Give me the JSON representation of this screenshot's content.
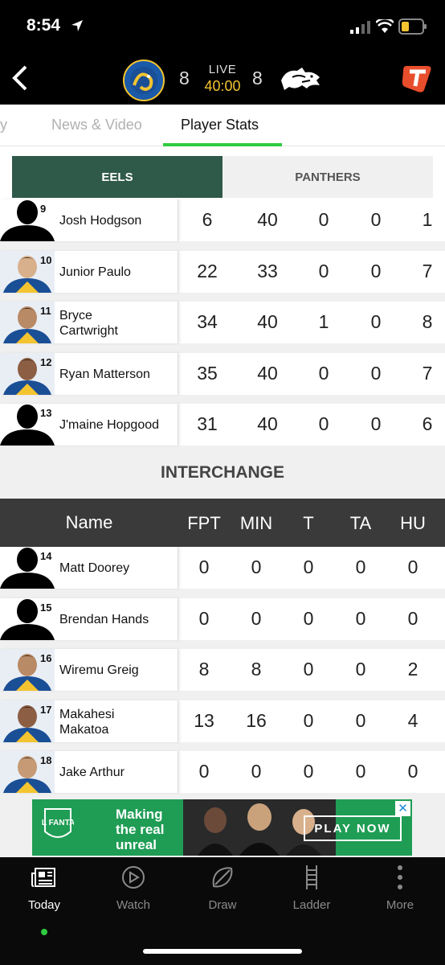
{
  "status_bar": {
    "time": "8:54"
  },
  "header": {
    "home_score": "8",
    "away_score": "8",
    "live_label": "LIVE",
    "clock": "40:00",
    "home_logo": "parramatta-eels-logo",
    "away_logo": "penrith-panthers-logo",
    "sponsor_logo": "telstra-logo",
    "home_logo_text": "PARRAMATTA EELS"
  },
  "tabs": {
    "partial": "ay",
    "news": "News & Video",
    "stats": "Player Stats"
  },
  "team_toggle": {
    "home": "EELS",
    "away": "PANTHERS"
  },
  "starters": [
    {
      "number": "9",
      "name": "Josh Hodgson",
      "fpt": "6",
      "min": "40",
      "t": "0",
      "ta": "0",
      "hu": "1",
      "photo": "silhouette"
    },
    {
      "number": "10",
      "name": "Junior Paulo",
      "fpt": "22",
      "min": "33",
      "t": "0",
      "ta": "0",
      "hu": "7",
      "photo": "headshot"
    },
    {
      "number": "11",
      "name": "Bryce Cartwright",
      "fpt": "34",
      "min": "40",
      "t": "1",
      "ta": "0",
      "hu": "8",
      "photo": "headshot"
    },
    {
      "number": "12",
      "name": "Ryan Matterson",
      "fpt": "35",
      "min": "40",
      "t": "0",
      "ta": "0",
      "hu": "7",
      "photo": "headshot"
    },
    {
      "number": "13",
      "name": "J'maine Hopgood",
      "fpt": "31",
      "min": "40",
      "t": "0",
      "ta": "0",
      "hu": "6",
      "photo": "silhouette"
    }
  ],
  "interchange": {
    "title": "INTERCHANGE",
    "columns": {
      "name": "Name",
      "fpt": "FPT",
      "min": "MIN",
      "t": "T",
      "ta": "TA",
      "hu": "HU"
    },
    "players": [
      {
        "number": "14",
        "name": "Matt Doorey",
        "fpt": "0",
        "min": "0",
        "t": "0",
        "ta": "0",
        "hu": "0",
        "photo": "silhouette"
      },
      {
        "number": "15",
        "name": "Brendan Hands",
        "fpt": "0",
        "min": "0",
        "t": "0",
        "ta": "0",
        "hu": "0",
        "photo": "silhouette"
      },
      {
        "number": "16",
        "name": "Wiremu Greig",
        "fpt": "8",
        "min": "8",
        "t": "0",
        "ta": "0",
        "hu": "2",
        "photo": "headshot"
      },
      {
        "number": "17",
        "name": "Makahesi Makatoa",
        "fpt": "13",
        "min": "16",
        "t": "0",
        "ta": "0",
        "hu": "4",
        "photo": "headshot"
      },
      {
        "number": "18",
        "name": "Jake Arthur",
        "fpt": "0",
        "min": "0",
        "t": "0",
        "ta": "0",
        "hu": "0",
        "photo": "headshot"
      }
    ]
  },
  "ad": {
    "headline": "Making the real unreal",
    "cta": "PLAY NOW",
    "brand": "NRL FANTASY",
    "close": "✕"
  },
  "bottom_nav": [
    {
      "label": "Today",
      "icon": "newspaper-icon",
      "active": true
    },
    {
      "label": "Watch",
      "icon": "play-icon",
      "active": false
    },
    {
      "label": "Draw",
      "icon": "football-icon",
      "active": false
    },
    {
      "label": "Ladder",
      "icon": "ladder-icon",
      "active": false
    },
    {
      "label": "More",
      "icon": "more-icon",
      "active": false
    }
  ],
  "colors": {
    "eels_green": "#2f5948",
    "accent_green": "#2ecc40",
    "clock_yellow": "#f4c430",
    "header_dark": "#3a3a3a"
  }
}
